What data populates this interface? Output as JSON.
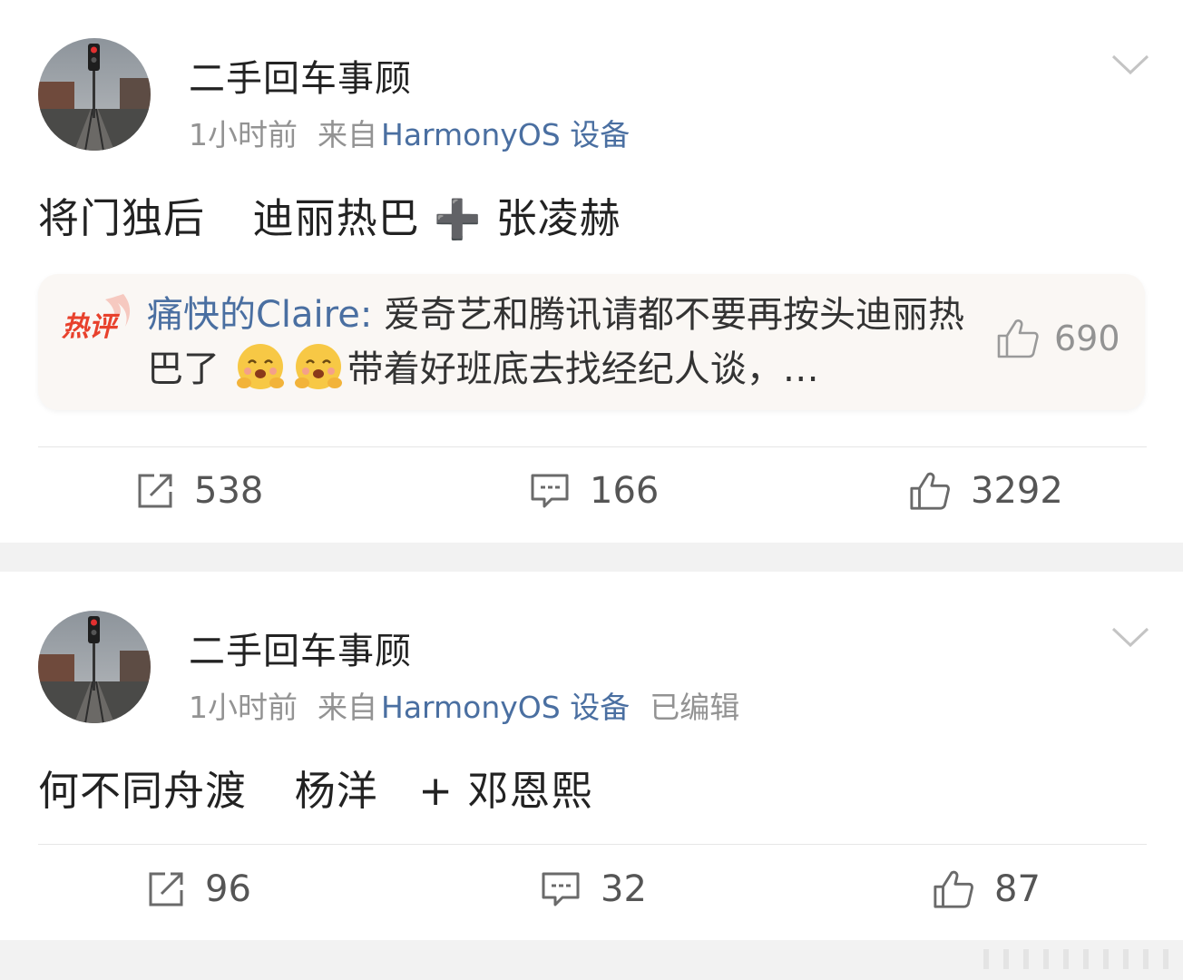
{
  "posts": [
    {
      "username": "二手回车事顾",
      "time": "1小时前",
      "from_label": "来自",
      "source": "HarmonyOS 设备",
      "edited": "",
      "content_parts": [
        "将门独后",
        "迪丽热巴",
        "张凌赫"
      ],
      "content_plus": "➕",
      "hot_comment": {
        "badge": "热评",
        "author": "痛快的Claire:",
        "text_before_emoji": "爱奇艺和腾讯请都不要再按头迪丽热巴了",
        "text_after_emoji": "带着好班底去找经纪人谈，…",
        "emoji": "hugging-face-emoji",
        "likes": "690"
      },
      "reposts": "538",
      "comments": "166",
      "likes": "3292"
    },
    {
      "username": "二手回车事顾",
      "time": "1小时前",
      "from_label": "来自",
      "source": "HarmonyOS 设备",
      "edited": "已编辑",
      "content_parts": [
        "何不同舟渡",
        "杨洋",
        "邓恩熙"
      ],
      "content_plus": "+",
      "reposts": "96",
      "comments": "32",
      "likes": "87"
    }
  ],
  "colors": {
    "link": "#4a6fa1",
    "meta": "#939393",
    "hot_badge": "#e8412c",
    "separator": "#f2f2f2"
  }
}
